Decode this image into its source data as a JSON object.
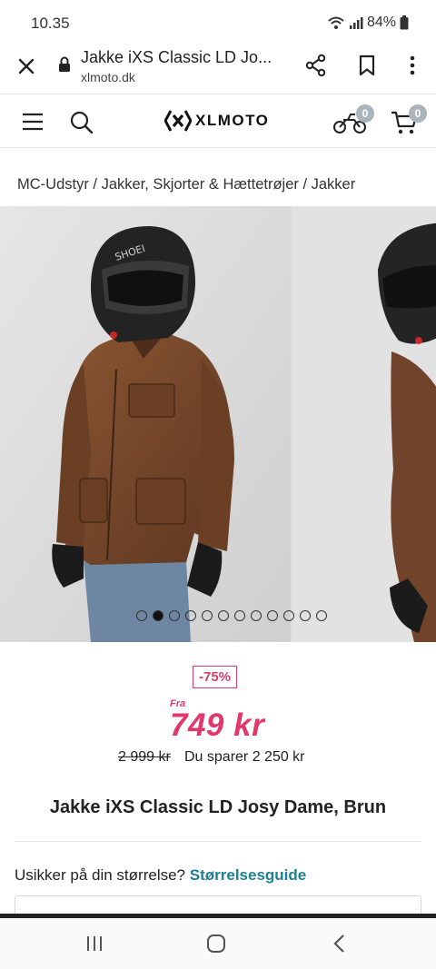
{
  "status_bar": {
    "time": "10.35",
    "battery": "84%"
  },
  "browser": {
    "tab_title": "Jakke iXS Classic LD Jo...",
    "url": "xlmoto.dk"
  },
  "header": {
    "logo": "XLMOTO",
    "garage_count": "0",
    "cart_count": "0"
  },
  "breadcrumb": "MC-Udstyr / Jakker, Skjorter & Hættetrøjer / Jakker",
  "gallery": {
    "slide_count": 12,
    "active_index": 1
  },
  "pricing": {
    "discount": "-75%",
    "from_label": "Fra",
    "price": "749 kr",
    "old_price": "2 999 kr",
    "savings": "Du sparer 2 250 kr"
  },
  "product": {
    "title": "Jakke iXS Classic LD Josy Dame, Brun",
    "size_question": "Usikker på din størrelse?",
    "size_guide_link": "Størrelsesguide"
  },
  "colors": {
    "accent": "#e0386a",
    "link": "#1d7f93",
    "jacket": "#7a4a2a",
    "badge": "#aab4ba"
  }
}
